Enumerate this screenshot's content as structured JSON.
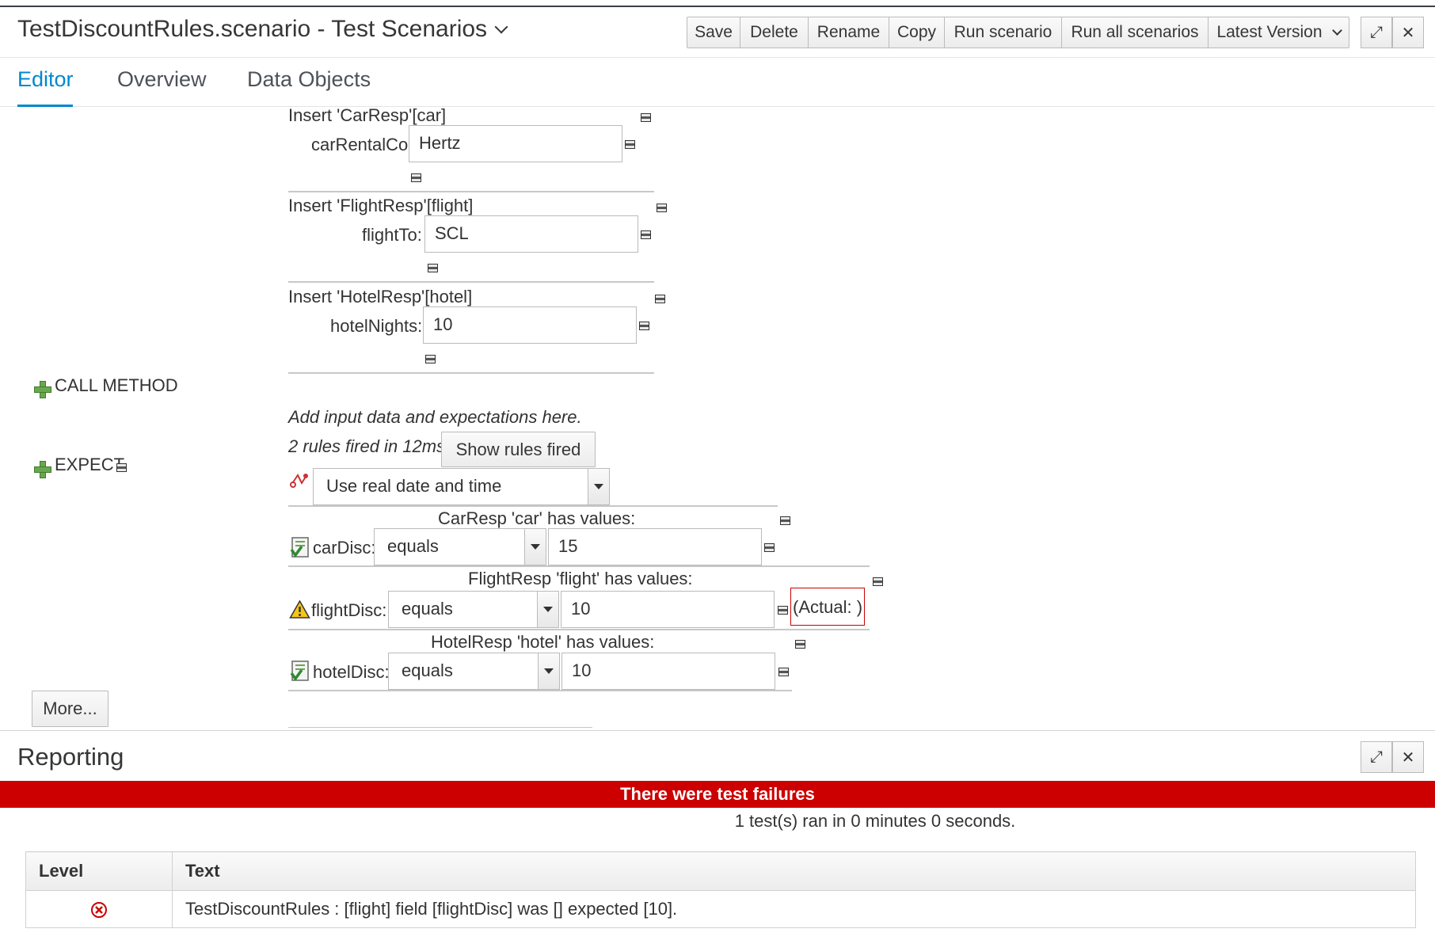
{
  "header": {
    "title": "TestDiscountRules.scenario - Test Scenarios",
    "toolbar": {
      "save": "Save",
      "delete": "Delete",
      "rename": "Rename",
      "copy": "Copy",
      "run_scenario": "Run scenario",
      "run_all": "Run all scenarios",
      "version": "Latest Version"
    }
  },
  "tabs": [
    "Editor",
    "Overview",
    "Data Objects"
  ],
  "given": [
    {
      "heading": "Insert 'CarResp'[car]",
      "field": "carRentalCo:",
      "value": "Hertz"
    },
    {
      "heading": "Insert 'FlightResp'[flight]",
      "field": "flightTo:",
      "value": "SCL"
    },
    {
      "heading": "Insert 'HotelResp'[hotel]",
      "field": "hotelNights:",
      "value": "10"
    }
  ],
  "call_method_label": "CALL METHOD",
  "expect_label": "EXPECT",
  "hint": "Add input data and expectations here.",
  "rules_fired": "2 rules fired in 12ms.",
  "show_rules_button": "Show rules fired",
  "date_mode": "Use real date and time",
  "expectations": [
    {
      "heading": "CarResp 'car' has values:",
      "field": "carDisc:",
      "operator": "equals",
      "value": "15",
      "status_icon": "check-icon"
    },
    {
      "heading": "FlightResp 'flight' has values:",
      "field": "flightDisc:",
      "operator": "equals",
      "value": "10",
      "actual": "(Actual: )",
      "status_icon": "warning-icon"
    },
    {
      "heading": "HotelResp 'hotel' has values:",
      "field": "hotelDisc:",
      "operator": "equals",
      "value": "10",
      "status_icon": "check-icon"
    }
  ],
  "more_button": "More...",
  "reporting": {
    "title": "Reporting",
    "failure_banner": "There were test failures",
    "summary": "1 test(s) ran in 0 minutes 0 seconds.",
    "columns": [
      "Level",
      "Text"
    ],
    "rows": [
      {
        "level_icon": "error-icon",
        "text": "TestDiscountRules : [flight] field [flightDisc] was [] expected [10]."
      }
    ]
  },
  "colors": {
    "accent": "#0088ce",
    "failure": "#cc0000"
  }
}
